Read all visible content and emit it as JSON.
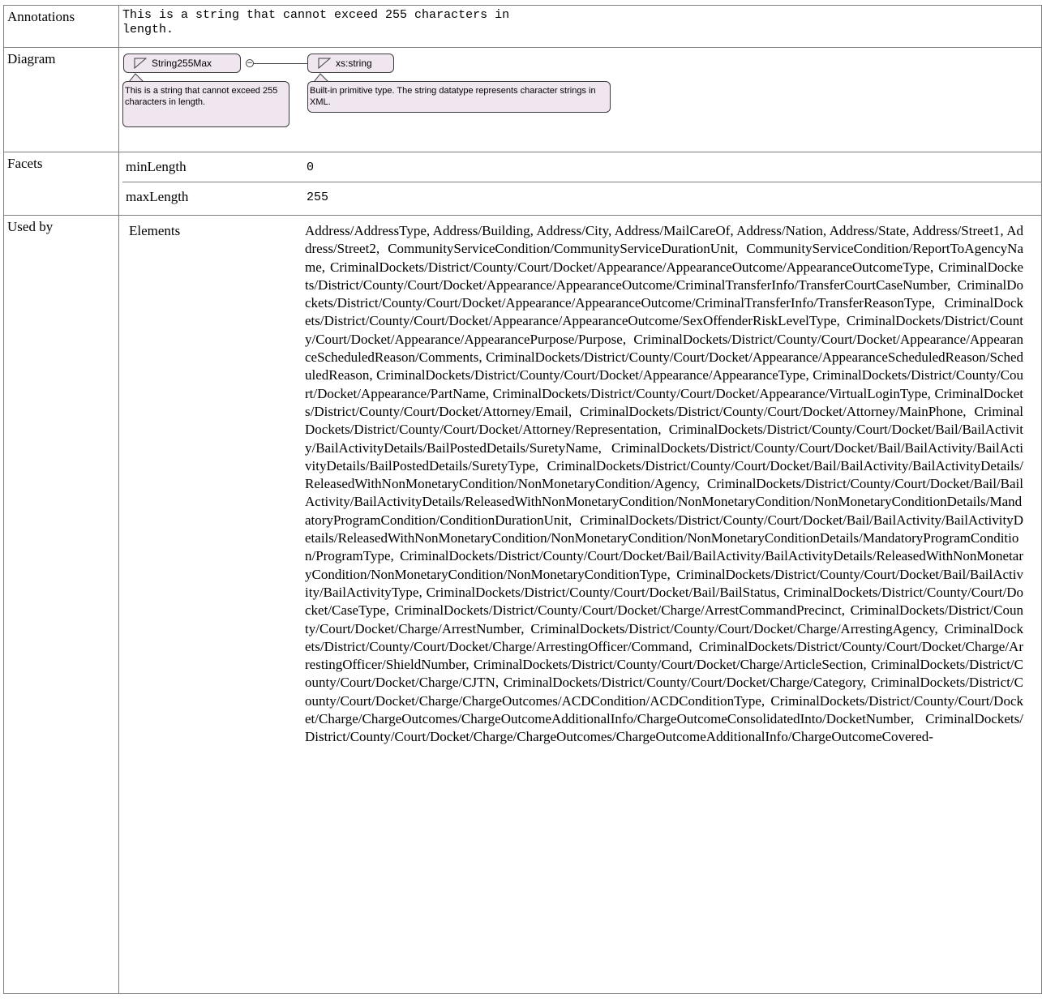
{
  "rows": {
    "annotations": {
      "label": "Annotations",
      "text": "This is a string that cannot exceed 255 characters in\nlength."
    },
    "diagram": {
      "label": "Diagram",
      "type_name": "String255Max",
      "type_doc": "This is a string that cannot exceed 255 characters in length.",
      "base_name": "xs:string",
      "base_doc": "Built-in primitive type. The string datatype represents character strings in XML."
    },
    "facets": {
      "label": "Facets",
      "items": [
        {
          "name": "minLength",
          "value": "0"
        },
        {
          "name": "maxLength",
          "value": "255"
        }
      ]
    },
    "used_by": {
      "label": "Used by",
      "kind": "Elements",
      "list": "Address/AddressType, Address/Building, Address/City, Address/MailCareOf, Address/Nation, Address/State, Address/Street1, Address/Street2, CommunityServiceCondition/CommunityServiceDurationUnit, CommunityServiceCondition/ReportToAgencyName, CriminalDockets/District/County/Court/Docket/Appearance/AppearanceOutcome/AppearanceOutcomeType, CriminalDockets/District/County/Court/Docket/Appearance/AppearanceOutcome/CriminalTransferInfo/TransferCourtCaseNumber, CriminalDockets/District/County/Court/Docket/Appearance/AppearanceOutcome/CriminalTransferInfo/TransferReasonType, CriminalDockets/District/County/Court/Docket/Appearance/AppearanceOutcome/SexOffenderRiskLevelType, CriminalDockets/District/County/Court/Docket/Appearance/AppearancePurpose/Purpose, CriminalDockets/District/County/Court/Docket/Appearance/AppearanceScheduledReason/Comments, CriminalDockets/District/County/Court/Docket/Appearance/AppearanceScheduledReason/ScheduledReason, CriminalDockets/District/County/Court/Docket/Appearance/AppearanceType, CriminalDockets/District/County/Court/Docket/Appearance/PartName, CriminalDockets/District/County/Court/Docket/Appearance/VirtualLoginType, CriminalDockets/District/County/Court/Docket/Attorney/Email, CriminalDockets/District/County/Court/Docket/Attorney/MainPhone, CriminalDockets/District/County/Court/Docket/Attorney/Representation, CriminalDockets/District/County/Court/Docket/Bail/BailActivity/BailActivityDetails/BailPostedDetails/SuretyName, CriminalDockets/District/County/Court/Docket/Bail/BailActivity/BailActivityDetails/BailPostedDetails/SuretyType, CriminalDockets/District/County/Court/Docket/Bail/BailActivity/BailActivityDetails/ReleasedWithNonMonetaryCondition/NonMonetaryCondition/Agency, CriminalDockets/District/County/Court/Docket/Bail/BailActivity/BailActivityDetails/ReleasedWithNonMonetaryCondition/NonMonetaryCondition/NonMonetaryConditionDetails/MandatoryProgramCondition/ConditionDurationUnit, CriminalDockets/District/County/Court/Docket/Bail/BailActivity/BailActivityDetails/ReleasedWithNonMonetaryCondition/NonMonetaryCondition/NonMonetaryConditionDetails/MandatoryProgramCondition/ProgramType, CriminalDockets/District/County/Court/Docket/Bail/BailActivity/BailActivityDetails/ReleasedWithNonMonetaryCondition/NonMonetaryCondition/NonMonetaryConditionType, CriminalDockets/District/County/Court/Docket/Bail/BailActivity/BailActivityType, CriminalDockets/District/County/Court/Docket/Bail/BailStatus, CriminalDockets/District/County/Court/Docket/CaseType, CriminalDockets/District/County/Court/Docket/Charge/ArrestCommandPrecinct, CriminalDockets/District/County/Court/Docket/Charge/ArrestNumber, CriminalDockets/District/County/Court/Docket/Charge/ArrestingAgency, CriminalDockets/District/County/Court/Docket/Charge/ArrestingOfficer/Command, CriminalDockets/District/County/Court/Docket/Charge/ArrestingOfficer/ShieldNumber, CriminalDockets/District/County/Court/Docket/Charge/ArticleSection, CriminalDockets/District/County/Court/Docket/Charge/CJTN, CriminalDockets/District/County/Court/Docket/Charge/Category, CriminalDockets/District/County/Court/Docket/Charge/ChargeOutcomes/ACDCondition/ACDConditionType, CriminalDockets/District/County/Court/Docket/Charge/ChargeOutcomes/ChargeOutcomeAdditionalInfo/ChargeOutcomeConsolidatedInto/DocketNumber, CriminalDockets/District/County/Court/Docket/Charge/ChargeOutcomes/ChargeOutcomeAdditionalInfo/ChargeOutcomeCovered-"
    }
  }
}
